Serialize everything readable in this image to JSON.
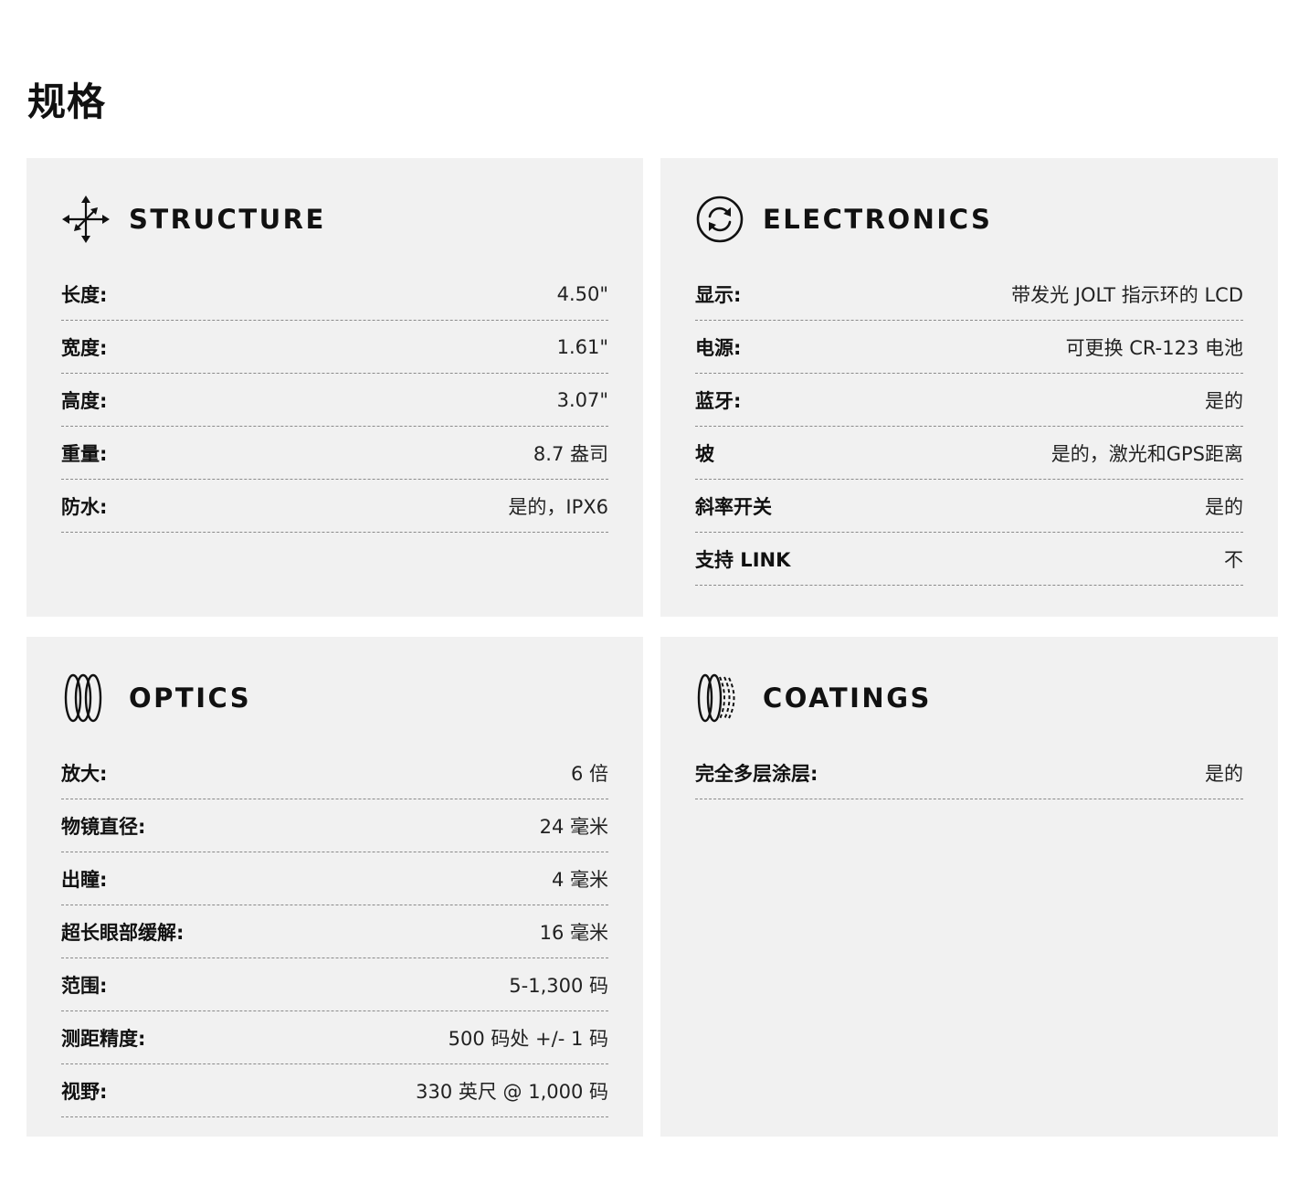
{
  "page": {
    "title": "规格"
  },
  "sections": {
    "structure": {
      "title": "STRUCTURE",
      "icon": "move-arrows-icon",
      "rows": [
        {
          "label": "长度:",
          "value": "4.50\""
        },
        {
          "label": "宽度:",
          "value": "1.61\""
        },
        {
          "label": "高度:",
          "value": "3.07\""
        },
        {
          "label": "重量:",
          "value": "8.7 盎司"
        },
        {
          "label": "防水:",
          "value": "是的，IPX6"
        }
      ]
    },
    "electronics": {
      "title": "ELECTRONICS",
      "icon": "refresh-circle-icon",
      "rows": [
        {
          "label": "显示:",
          "value": "带发光 JOLT 指示环的 LCD"
        },
        {
          "label": "电源:",
          "value": "可更换 CR-123 电池"
        },
        {
          "label": "蓝牙:",
          "value": "是的"
        },
        {
          "label": "坡",
          "value": "是的，激光和GPS距离"
        },
        {
          "label": "斜率开关",
          "value": "是的"
        },
        {
          "label": "支持 LINK",
          "value": "不"
        }
      ]
    },
    "optics": {
      "title": "OPTICS",
      "icon": "lenses-icon",
      "rows": [
        {
          "label": "放大:",
          "value": "6 倍"
        },
        {
          "label": "物镜直径:",
          "value": "24 毫米"
        },
        {
          "label": "出瞳:",
          "value": "4 毫米"
        },
        {
          "label": "超长眼部缓解:",
          "value": "16 毫米"
        },
        {
          "label": "范围:",
          "value": "5-1,300 码"
        },
        {
          "label": "测距精度:",
          "value": "500 码处 +/- 1 码"
        },
        {
          "label": "视野:",
          "value": "330 英尺 @ 1,000 码"
        }
      ]
    },
    "coatings": {
      "title": "COATINGS",
      "icon": "coated-lens-icon",
      "rows": [
        {
          "label": "完全多层涂层:",
          "value": "是的"
        }
      ]
    }
  }
}
